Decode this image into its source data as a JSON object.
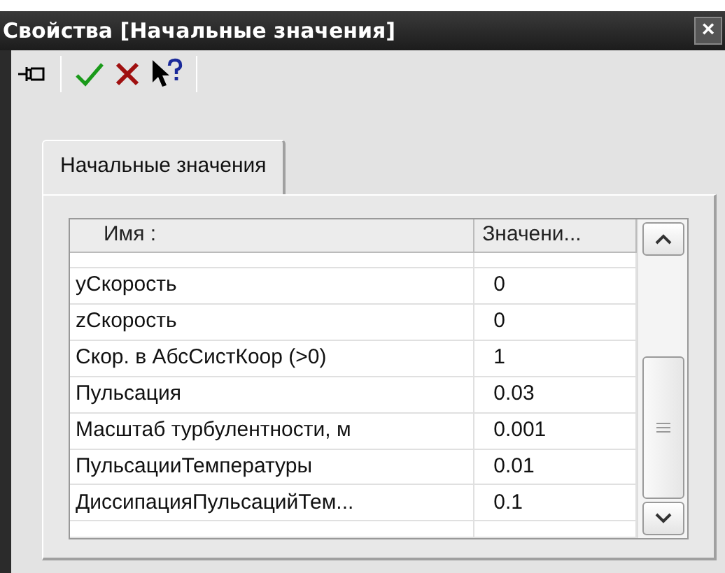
{
  "window": {
    "title": "Свойства [Начальные значения]",
    "close": "×"
  },
  "tabs": [
    {
      "label": "Начальные значения",
      "selected": true
    }
  ],
  "table": {
    "columns": [
      "Имя :",
      "Значени..."
    ],
    "rows": [
      {
        "name": "уСкорость",
        "value": "0"
      },
      {
        "name": "zСкорость",
        "value": "0"
      },
      {
        "name": "Скор. в АбсСистКоор (>0)",
        "value": "1"
      },
      {
        "name": "Пульсация",
        "value": "0.03"
      },
      {
        "name": "Масштаб турбулентности, м",
        "value": "0.001"
      },
      {
        "name": "ПульсацииТемпературы",
        "value": "0.01"
      },
      {
        "name": "ДиссипацияПульсацийТем...",
        "value": "0.1"
      }
    ]
  }
}
